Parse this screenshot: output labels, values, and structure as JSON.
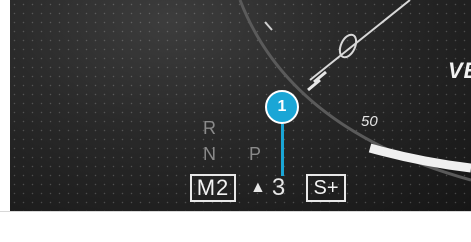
{
  "gear_selector": {
    "gears": [
      "R",
      "N",
      "P"
    ],
    "current_gear": "M2",
    "upshift_indicator_gear": "3",
    "mode": "S+"
  },
  "callout": {
    "number": "1"
  },
  "speedometer": {
    "tick_label": "50",
    "brand_partial": "VE"
  },
  "colors": {
    "callout": "#1aa6d6",
    "background_dark": "#1b1b1b",
    "text_light": "#f2f2f2",
    "text_dim": "#8a8a8a"
  },
  "icons": {
    "upshift": "up-arrow-icon"
  }
}
